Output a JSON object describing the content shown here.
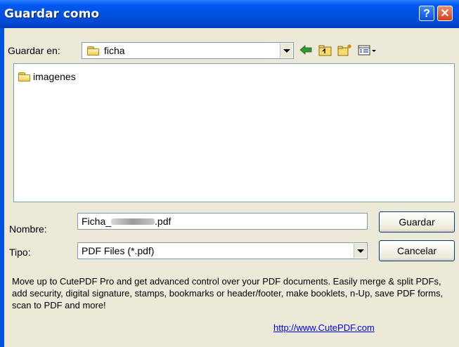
{
  "window": {
    "title": "Guardar como"
  },
  "titlebar": {
    "help_glyph": "?",
    "close_glyph": "✕"
  },
  "location": {
    "label": "Guardar en:",
    "value": "ficha"
  },
  "toolbar": {
    "back_icon": "arrow-left-icon",
    "up_icon": "folder-up-icon",
    "new_folder_icon": "new-folder-icon",
    "views_icon": "views-menu-icon"
  },
  "files": [
    {
      "name": "imagenes",
      "icon": "folder-icon"
    }
  ],
  "filename": {
    "label": "Nombre:",
    "prefix": "Ficha_",
    "suffix": ".pdf"
  },
  "filetype": {
    "label": "Tipo:",
    "value": "PDF Files (*.pdf)"
  },
  "buttons": {
    "save": "Guardar",
    "cancel": "Cancelar"
  },
  "promo": {
    "text": "Move up to CutePDF Pro and get advanced control over your PDF documents. Easily merge & split PDFs, add security, digital signature, stamps, bookmarks or header/footer, make booklets, n-Up, save PDF forms, scan to PDF and more!",
    "link": "http://www.CutePDF.com"
  },
  "colors": {
    "titlebar": "#0054e3",
    "dialog_bg": "#ece9d8",
    "link": "#0000ee",
    "close": "#d5401b"
  }
}
